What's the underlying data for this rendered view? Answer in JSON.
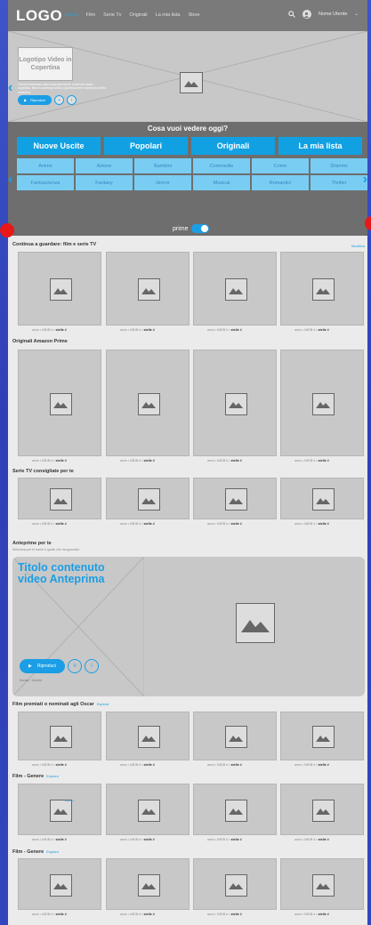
{
  "nav": {
    "logo": "LOGO",
    "links": [
      "Home",
      "Film",
      "Serie Tv",
      "Originali",
      "La mia lista",
      "Store"
    ],
    "user": "Nome Utente"
  },
  "hero": {
    "logo_text": "Logotipo Video in Copertina",
    "description": "Trama/ premessa video copertina breve contenuto video copertina. Breve contenuto video copertina breve contenuto video copertina.",
    "play_label": "Riproduci",
    "add_icon": "plus-icon",
    "info_icon": "info-icon"
  },
  "categories": {
    "title": "Cosa vuoi vedere oggi?",
    "tabs": [
      "Nuove Uscite",
      "Popolari",
      "Originali",
      "La mia lista"
    ],
    "genres": [
      "Anime",
      "Azione",
      "Bambini",
      "Commedie",
      "Crime",
      "Drammi",
      "Fantascienza",
      "Fantasy",
      "Horror",
      "Musical",
      "Romantici",
      "Thriller"
    ],
    "prime_label": "prime"
  },
  "sections": {
    "continua": {
      "title": "Continua a guardare: film e serie TV",
      "action": "Modifica"
    },
    "originali": {
      "title": "Originali Amazon Prime"
    },
    "serie": {
      "title": "Serie TV consigliate per te"
    },
    "anteprime": {
      "title": "Anteprime per te",
      "subtitle": "Seleziona per le trame e quello che hai guardato"
    },
    "premiati": {
      "title": "Film premiati o nominati agli Oscar",
      "action": "Esplora"
    },
    "genere1": {
      "title": "Film - Genere",
      "action": "Esplora"
    },
    "genere2": {
      "title": "Film - Genere",
      "action": "Esplora"
    }
  },
  "card_meta": {
    "year": "anno",
    "imdb": "IMDB #",
    "stars": "stelle #"
  },
  "preview": {
    "title": "Titolo contenuto video Anteprima",
    "play_label": "Riproduci",
    "subs_icon": "subtitles-icon",
    "info_icon": "info-icon",
    "info": "Durata · Genere"
  },
  "explore_tag": "Esplora",
  "colors": {
    "accent": "#1b9ee5",
    "genre_bg": "#79cdf2",
    "navbar": "#7a7a7a",
    "category_bg": "#6e6e6e",
    "marker": "#e81818"
  }
}
